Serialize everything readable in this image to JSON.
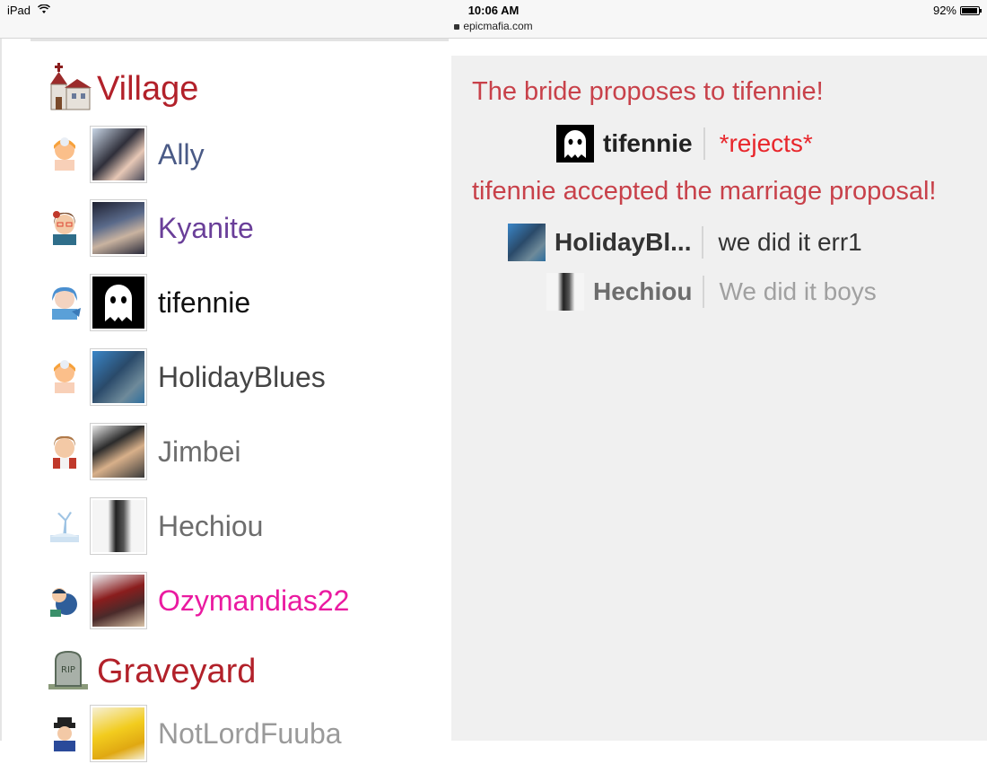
{
  "statusbar": {
    "device": "iPad",
    "time": "10:06 AM",
    "url": "epicmafia.com",
    "battery": "92%",
    "battery_level": 0.92
  },
  "village": {
    "title": "Village",
    "players": [
      {
        "name": "Ally",
        "color": "#4a5a86"
      },
      {
        "name": "Kyanite",
        "color": "#6a3f99"
      },
      {
        "name": "tifennie",
        "color": "#111111"
      },
      {
        "name": "HolidayBlues",
        "color": "#444444"
      },
      {
        "name": "Jimbei",
        "color": "#6d6d6d"
      },
      {
        "name": "Hechiou",
        "color": "#6d6d6d"
      },
      {
        "name": "Ozymandias22",
        "color": "#ea1aa0"
      }
    ]
  },
  "graveyard": {
    "title": "Graveyard",
    "players": [
      {
        "name": "NotLordFuuba",
        "color": "#9a9a9a"
      }
    ]
  },
  "chat": {
    "system1": "The bride proposes to tifennie!",
    "msg1": {
      "name": "tifennie",
      "text": "*rejects*"
    },
    "system2": "tifennie accepted the marriage proposal!",
    "msg2": {
      "name": "HolidayBl...",
      "text": "we did it err1"
    },
    "msg3": {
      "name": "Hechiou",
      "text": "We did it boys"
    }
  },
  "colors": {
    "header_red": "#b2212a",
    "system_red": "#c8414a",
    "reject_red": "#e8262b",
    "chat_bg": "#f0f0f0"
  }
}
